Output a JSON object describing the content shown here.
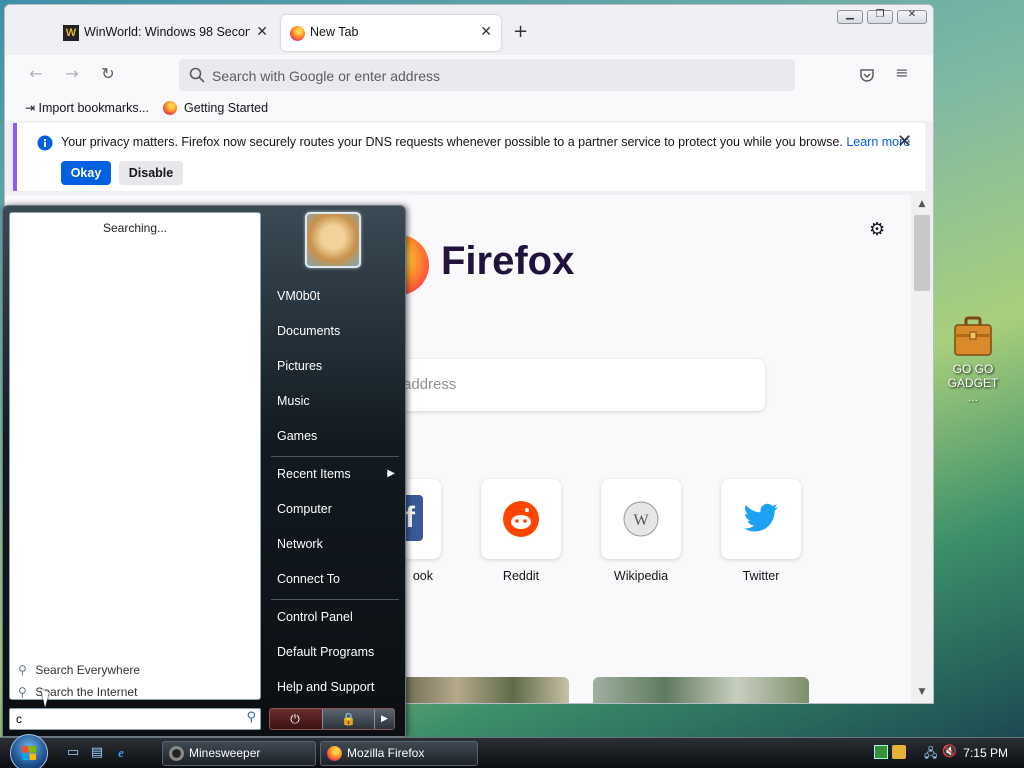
{
  "desktop": {
    "icon_label": "GO GO GADGET ..."
  },
  "browser": {
    "tabs": [
      {
        "title": "WinWorld: Windows 98 Second",
        "favicon": "W",
        "active": false
      },
      {
        "title": "New Tab",
        "active": true
      }
    ],
    "url_placeholder": "Search with Google or enter address",
    "bookmarks": [
      {
        "label": "Import bookmarks..."
      },
      {
        "label": "Getting Started"
      }
    ],
    "notice": {
      "message": "Your privacy matters. Firefox now securely routes your DNS requests whenever possible to a partner service to protect you while you browse.",
      "learn_more": "Learn more",
      "okay": "Okay",
      "disable": "Disable"
    },
    "newtab": {
      "wordmark": "Firefox",
      "search_placeholder_visible": "address",
      "top_sites": [
        {
          "label": "ook",
          "icon": "facebook-icon",
          "color": "#3b5998"
        },
        {
          "label": "Reddit",
          "icon": "reddit-icon",
          "color": "#ff4500"
        },
        {
          "label": "Wikipedia",
          "icon": "wikipedia-icon",
          "color": "#777777"
        },
        {
          "label": "Twitter",
          "icon": "twitter-icon",
          "color": "#1da1f2"
        }
      ]
    }
  },
  "start_menu": {
    "status": "Searching...",
    "search_links": [
      {
        "label": "Search Everywhere"
      },
      {
        "label": "Search the Internet"
      }
    ],
    "search_value": "c",
    "user": "VM0b0t",
    "items": [
      {
        "label": "Documents"
      },
      {
        "label": "Pictures"
      },
      {
        "label": "Music"
      },
      {
        "label": "Games"
      },
      {
        "label": "Recent Items",
        "submenu": true
      },
      {
        "label": "Computer"
      },
      {
        "label": "Network"
      },
      {
        "label": "Connect To"
      },
      {
        "label": "Control Panel"
      },
      {
        "label": "Default Programs"
      },
      {
        "label": "Help and Support"
      }
    ]
  },
  "taskbar": {
    "buttons": [
      {
        "label": "Minesweeper"
      },
      {
        "label": "Mozilla Firefox"
      }
    ],
    "clock": "7:15 PM"
  }
}
